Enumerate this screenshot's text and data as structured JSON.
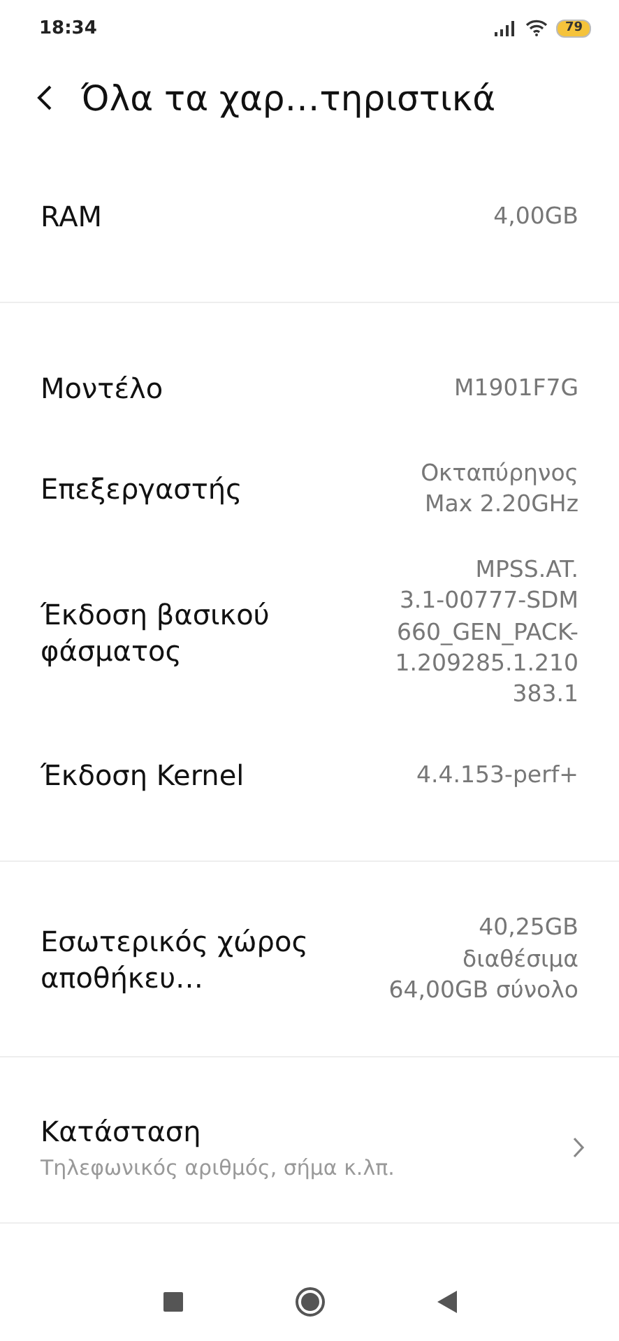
{
  "status_bar": {
    "time": "18:34",
    "battery": "79"
  },
  "header": {
    "title": "Όλα τα χαρ…τηριστικά"
  },
  "groups": [
    [
      {
        "label": "RAM",
        "value_lines": [
          "4,00GB"
        ]
      }
    ],
    [
      {
        "label": "Μοντέλο",
        "value_lines": [
          "M1901F7G"
        ]
      },
      {
        "label": "Επεξεργαστής",
        "value_lines": [
          "Οκταπύρηνος",
          "Max 2.20GHz"
        ]
      },
      {
        "label": "Έκδοση βασικού φάσματος",
        "value_lines": [
          "MPSS.AT.",
          "3.1-00777-SDM",
          "660_GEN_PACK-",
          "1.209285.1.210",
          "383.1"
        ]
      },
      {
        "label": "Έκδοση Kernel",
        "value_lines": [
          "4.4.153-perf+"
        ]
      }
    ],
    [
      {
        "label": "Εσωτερικός χώρος αποθήκευ…",
        "value_lines": [
          "40,25GB",
          "διαθέσιμα",
          "64,00GB σύνολο"
        ]
      }
    ]
  ],
  "status_item": {
    "title": "Κατάσταση",
    "subtitle": "Τηλεφωνικός αριθμός, σήμα κ.λπ."
  }
}
